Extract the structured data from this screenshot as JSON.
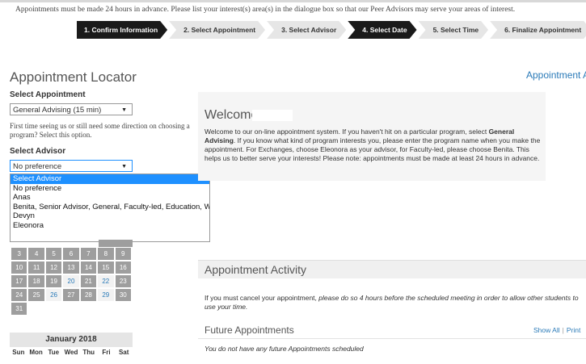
{
  "notice": "Appointments must be made 24 hours in advance. Please list your interest(s) area(s) in the dialogue box so that our Peer Advisors may serve your areas of interest.",
  "steps": [
    {
      "label": "1. Confirm Information"
    },
    {
      "label": "2. Select Appointment"
    },
    {
      "label": "3. Select Advisor"
    },
    {
      "label": "4. Select Date"
    },
    {
      "label": "5. Select Time"
    },
    {
      "label": "6. Finalize Appointment"
    }
  ],
  "locator": {
    "title": "Appointment Locator",
    "right_link": "Appointment A",
    "select_appointment_label": "Select Appointment",
    "appointment_value": "General Advising (15 min)",
    "help_text": "First time seeing us or still need some direction on choosing a program? Select this option.",
    "select_advisor_label": "Select Advisor",
    "advisor_value": "No preference",
    "advisor_options": [
      "Select Advisor",
      "No preference",
      "Anas",
      "Benita, Senior Advisor, General, Faculty-led, Education, Wor...",
      "Devyn",
      "Eleonora"
    ]
  },
  "calendar": {
    "weeks": [
      [
        "3",
        "4",
        "5",
        "6",
        "7",
        "8",
        "9"
      ],
      [
        "10",
        "11",
        "12",
        "13",
        "14",
        "15",
        "16"
      ],
      [
        "17",
        "18",
        "19",
        "20",
        "21",
        "22",
        "23"
      ],
      [
        "24",
        "25",
        "26",
        "27",
        "28",
        "29",
        "30"
      ],
      [
        "31",
        "",
        "",
        "",
        "",
        "",
        ""
      ]
    ],
    "available_days": [
      "20",
      "22",
      "26",
      "29"
    ],
    "next_month": "January 2018",
    "weekdays": [
      "Sun",
      "Mon",
      "Tue",
      "Wed",
      "Thu",
      "Fri",
      "Sat"
    ]
  },
  "welcome": {
    "title": "Welcome",
    "text_before": "Welcome to our on-line appointment system. If you  haven't hit on a particular program, select ",
    "bold": "General Advising",
    "text_after": ". If you know what kind of program interests you, please enter the program name when you make the appointment. For Exchanges, choose Eleonora as your advisor, for Faculty-led, please choose Benita. This helps us to better serve your interests! Please note: appointments must be made at least 24 hours in advance."
  },
  "activity": {
    "title": "Appointment Activity",
    "note_lead": "If you must cancel your appointment, ",
    "note_italic": "please do so 4 hours before the scheduled meeting in order to allow other students to use your time.",
    "future_title": "Future Appointments",
    "show_all": "Show All",
    "print": "Print",
    "empty": "You do not have any future Appointments scheduled"
  },
  "colors": {
    "highlight": "#1e90ff",
    "link": "#2a7ab8",
    "step_active": "#1a1a1a"
  }
}
